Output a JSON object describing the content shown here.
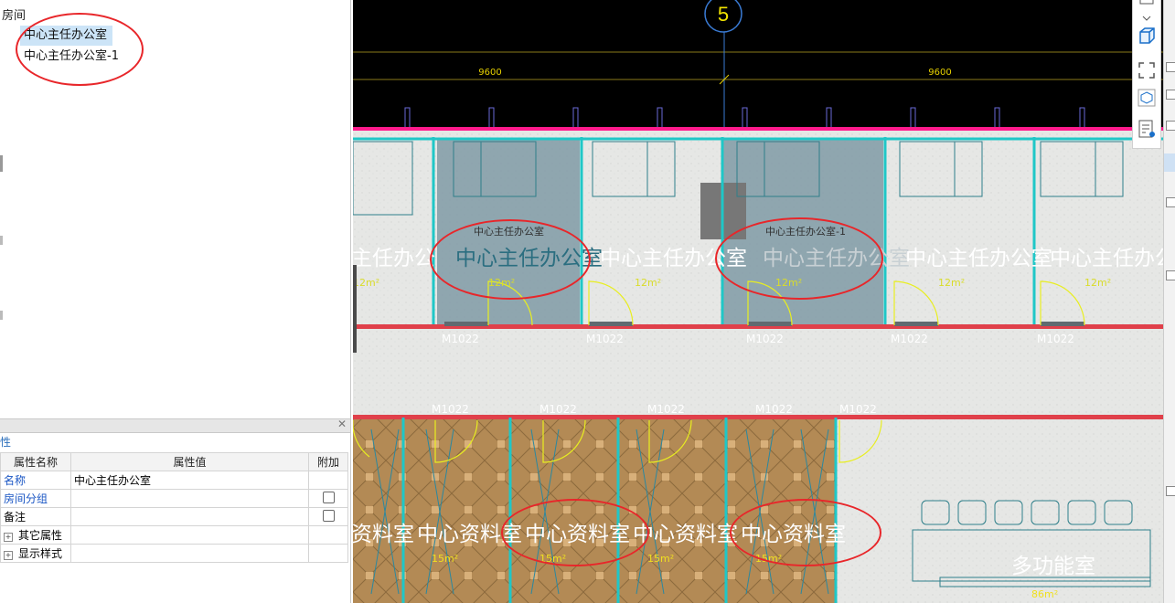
{
  "tree": {
    "title": "房间",
    "items": [
      "中心主任办公室",
      "中心主任办公室-1"
    ]
  },
  "properties": {
    "tab_label": "性",
    "columns": [
      "属性名称",
      "属性值",
      "附加"
    ],
    "rows": [
      {
        "name": "名称",
        "value": "中心主任办公室"
      },
      {
        "name": "房间分组",
        "value": ""
      },
      {
        "name": "备注",
        "value": ""
      }
    ],
    "groups": [
      "其它属性",
      "显示样式"
    ]
  },
  "drawing": {
    "axis_label": "5",
    "dim_left": "9600",
    "dim_right": "9600",
    "rooms_top": {
      "big_labels": [
        "主任办公",
        "中心主任办公室",
        "中心主任办公室",
        "中心主任办公室",
        "中心主任办公室",
        "中心主任办公室",
        "中心主任办"
      ],
      "small_labels": [
        "中心主任办公室",
        "中心主任办公室-1"
      ],
      "areas": [
        "12m²",
        "12m²",
        "12m²",
        "12m²",
        "12m²",
        "12m²"
      ],
      "door_labels": [
        "M1022",
        "M1022",
        "M1022",
        "M1022",
        "M1022"
      ]
    },
    "rooms_bottom": {
      "door_labels": [
        "M1022",
        "M1022",
        "M1022",
        "M1022",
        "M1022"
      ],
      "big_labels": [
        "资料室",
        "中心资料室",
        "中心资料室",
        "中心资料室",
        "中心资料室"
      ],
      "areas": [
        "15m²",
        "15m²",
        "15m²",
        "15m²",
        "15m²"
      ],
      "multi_room": "多功能室",
      "multi_area": "86m²"
    }
  },
  "colors": {
    "annotation": "#e8262a",
    "wall": "#1fc7c7",
    "red_wall": "#e0404a",
    "floor_wood": "#b38a55",
    "selected_room": "#7f9aa6"
  }
}
